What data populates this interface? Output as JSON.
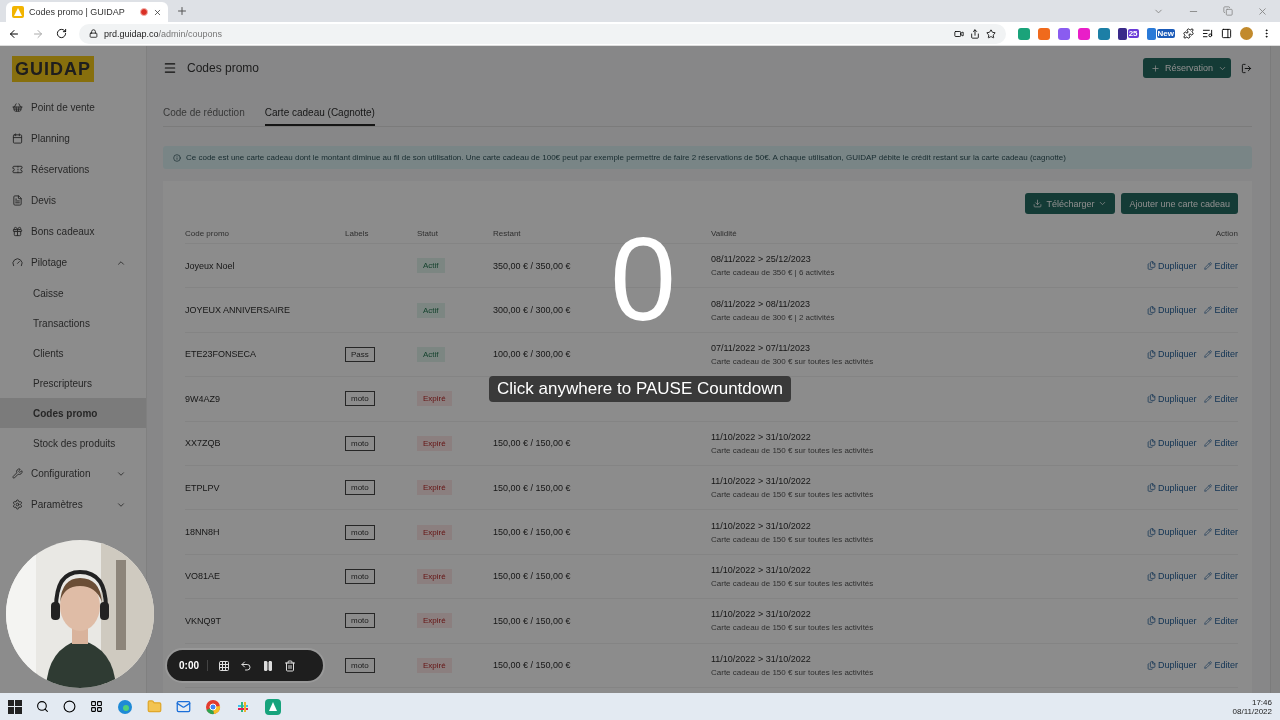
{
  "browser": {
    "tab_title": "Codes promo | GUIDAP",
    "url_domain": "prd.guidap.co",
    "url_path": "/admin/coupons",
    "extension_badges": [
      "25",
      "New"
    ]
  },
  "sidebar": {
    "logo": "GUIDAP",
    "items": [
      {
        "label": "Point de vente",
        "selected": false
      },
      {
        "label": "Planning",
        "selected": false
      },
      {
        "label": "Réservations",
        "selected": false
      },
      {
        "label": "Devis",
        "selected": false
      },
      {
        "label": "Bons cadeaux",
        "selected": false
      },
      {
        "label": "Pilotage",
        "selected": false,
        "expanded": true,
        "children": [
          {
            "label": "Caisse",
            "selected": false
          },
          {
            "label": "Transactions",
            "selected": false
          },
          {
            "label": "Clients",
            "selected": false
          },
          {
            "label": "Prescripteurs",
            "selected": false
          },
          {
            "label": "Codes promo",
            "selected": true
          },
          {
            "label": "Stock des produits",
            "selected": false
          }
        ]
      },
      {
        "label": "Configuration",
        "selected": false,
        "expanded": false
      },
      {
        "label": "Paramètres",
        "selected": false,
        "expanded": false
      }
    ]
  },
  "header": {
    "title": "Codes promo",
    "primary_button": "Réservation"
  },
  "tabs": [
    {
      "label": "Code de réduction",
      "selected": false
    },
    {
      "label": "Carte cadeau (Cagnotte)",
      "selected": true
    }
  ],
  "info": "Ce code est une carte cadeau dont le montant diminue au fil de son utilisation. Une carte cadeau de 100€ peut par exemple permettre de faire 2 réservations de 50€. A chaque utilisation, GUIDAP débite le crédit restant sur la carte cadeau (cagnotte)",
  "actions": {
    "download": "Télécharger",
    "add": "Ajouter une carte cadeau"
  },
  "table": {
    "columns": [
      "Code promo",
      "Labels",
      "Statut",
      "Restant",
      "Validité",
      "Action"
    ],
    "rows": [
      {
        "code": "Joyeux Noel",
        "status": {
          "label": "Actif",
          "kind": "active"
        },
        "remaining": "350,00 € / 350,00 €",
        "validity": "08/11/2022 > 25/12/2023",
        "description": "Carte cadeau de 350 € | 6 activités",
        "duplicate": "Dupliquer",
        "edit": "Editer"
      },
      {
        "code": "JOYEUX ANNIVERSAIRE",
        "status": {
          "label": "Actif",
          "kind": "active"
        },
        "remaining": "300,00 € / 300,00 €",
        "validity": "08/11/2022 > 08/11/2023",
        "description": "Carte cadeau de 300 € | 2 activités",
        "duplicate": "Dupliquer",
        "edit": "Editer"
      },
      {
        "code": "ETE23FONSECA",
        "label": "Pass",
        "status": {
          "label": "Actif",
          "kind": "active"
        },
        "remaining": "100,00 € / 300,00 €",
        "validity": "07/11/2022 > 07/11/2023",
        "description": "Carte cadeau de 300 € sur toutes les activités",
        "duplicate": "Dupliquer",
        "edit": "Editer"
      },
      {
        "code": "9W4AZ9",
        "label": "moto",
        "status": {
          "label": "Expiré",
          "kind": "expired"
        },
        "duplicate": "Dupliquer",
        "edit": "Editer"
      },
      {
        "code": "XX7ZQB",
        "label": "moto",
        "status": {
          "label": "Expiré",
          "kind": "expired"
        },
        "remaining": "150,00 € / 150,00 €",
        "validity": "11/10/2022 > 31/10/2022",
        "description": "Carte cadeau de 150 € sur toutes les activités",
        "duplicate": "Dupliquer",
        "edit": "Editer"
      },
      {
        "code": "ETPLPV",
        "label": "moto",
        "status": {
          "label": "Expiré",
          "kind": "expired"
        },
        "remaining": "150,00 € / 150,00 €",
        "validity": "11/10/2022 > 31/10/2022",
        "description": "Carte cadeau de 150 € sur toutes les activités",
        "duplicate": "Dupliquer",
        "edit": "Editer"
      },
      {
        "code": "18NN8H",
        "label": "moto",
        "status": {
          "label": "Expiré",
          "kind": "expired"
        },
        "remaining": "150,00 € / 150,00 €",
        "validity": "11/10/2022 > 31/10/2022",
        "description": "Carte cadeau de 150 € sur toutes les activités",
        "duplicate": "Dupliquer",
        "edit": "Editer"
      },
      {
        "code": "VO81AE",
        "label": "moto",
        "status": {
          "label": "Expiré",
          "kind": "expired"
        },
        "remaining": "150,00 € / 150,00 €",
        "validity": "11/10/2022 > 31/10/2022",
        "description": "Carte cadeau de 150 € sur toutes les activités",
        "duplicate": "Dupliquer",
        "edit": "Editer"
      },
      {
        "code": "VKNQ9T",
        "label": "moto",
        "status": {
          "label": "Expiré",
          "kind": "expired"
        },
        "remaining": "150,00 € / 150,00 €",
        "validity": "11/10/2022 > 31/10/2022",
        "description": "Carte cadeau de 150 € sur toutes les activités",
        "duplicate": "Dupliquer",
        "edit": "Editer"
      },
      {
        "label": "moto",
        "status": {
          "label": "Expiré",
          "kind": "expired"
        },
        "remaining": "150,00 € / 150,00 €",
        "validity": "11/10/2022 > 31/10/2022",
        "description": "Carte cadeau de 150 € sur toutes les activités",
        "duplicate": "Dupliquer",
        "edit": "Editer"
      }
    ]
  },
  "countdown": {
    "number": "0",
    "message": "Click anywhere to PAUSE Countdown"
  },
  "recorder": {
    "time": "0:00"
  },
  "taskbar": {
    "time": "17:46",
    "date": "08/11/2022"
  }
}
